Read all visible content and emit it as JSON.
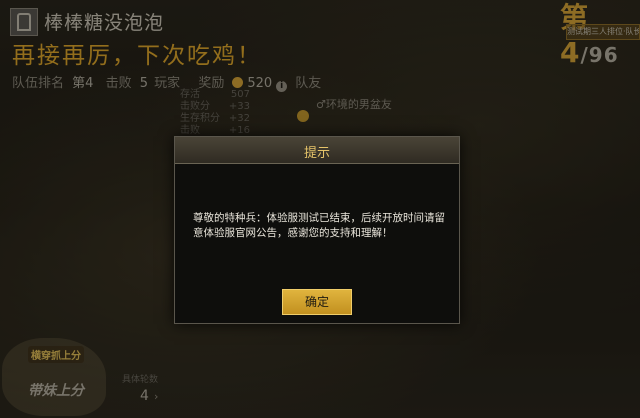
{
  "player": {
    "name": "棒棒糖没泡泡"
  },
  "headline": "再接再厉，下次吃鸡！",
  "stats": {
    "team_rank_label": "队伍排名",
    "team_rank_value": "第4",
    "kills_label": "击败",
    "kills_value": "5",
    "kills_unit": "玩家",
    "reward_label": "奖励",
    "reward_value": "520",
    "teammates_label": "队友"
  },
  "reward_details": [
    {
      "label": "存活",
      "value": "507"
    },
    {
      "label": "击败分",
      "value": "+33"
    },
    {
      "label": "生存积分",
      "value": "+32"
    },
    {
      "label": "击败",
      "value": "+16"
    }
  ],
  "teammate": {
    "name": "♂环境的男盆友"
  },
  "rank": {
    "place": "第 4",
    "total": "/96"
  },
  "rank_tag": "测试期三人排位·队长·总排名",
  "promo": {
    "line1": "横穿抓上分",
    "line2": "带妹上分"
  },
  "rounds": {
    "label": "具体轮数",
    "value": "4"
  },
  "dialog": {
    "title": "提示",
    "message": "尊敬的特种兵：体验服测试已结束，后续开放时间请留意体验服官网公告，感谢您的支持和理解！",
    "confirm_label": "确定"
  },
  "colors": {
    "accent": "#e2a92c",
    "button": "#d4a533",
    "dialog_title": "#e6c46a"
  }
}
